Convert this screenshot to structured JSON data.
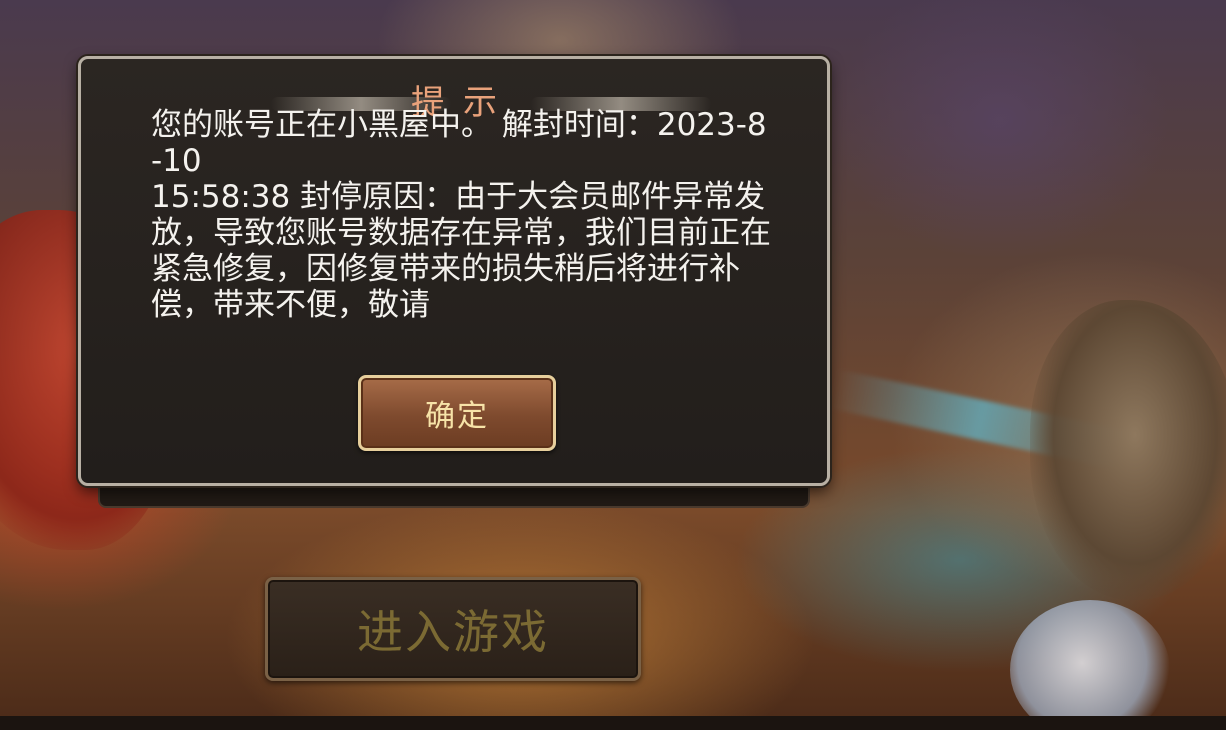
{
  "dialog": {
    "title": "提示",
    "message": "您的账号正在小黑屋中。 解封时间：2023-8-10\n15:58:38 封停原因：由于大会员邮件异常发放，导致您账号数据存在异常，我们目前正在紧急修复，因修复带来的损失稍后将进行补偿，带来不便，敬请",
    "confirm_label": "确定"
  },
  "main": {
    "enter_game_label": "进入游戏"
  },
  "colors": {
    "dialog_title": "#e9a27b",
    "confirm_text": "#f7e3a8",
    "enter_game_text": "#7b6a33"
  }
}
